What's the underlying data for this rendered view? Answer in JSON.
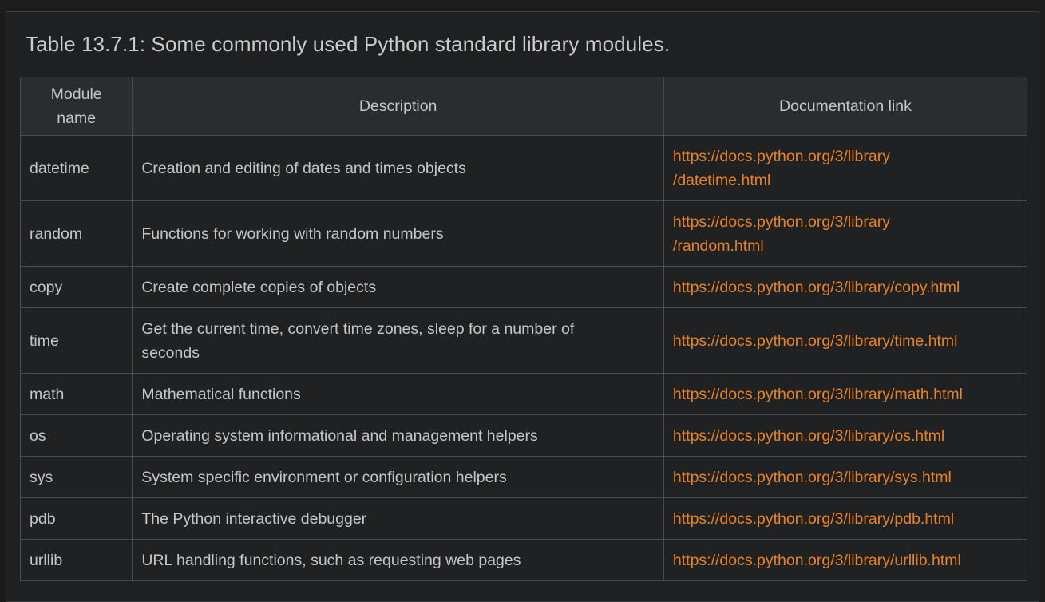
{
  "caption": "Table 13.7.1: Some commonly used Python standard library modules.",
  "table": {
    "headers": {
      "module": "Module name",
      "description": "Description",
      "link": "Documentation link"
    },
    "rows": [
      {
        "module": "datetime",
        "description": "Creation and editing of dates and times objects",
        "link_line1": "https://docs.python.org/3/library",
        "link_line2": "/datetime.html"
      },
      {
        "module": "random",
        "description": "Functions for working with random numbers",
        "link_line1": "https://docs.python.org/3/library",
        "link_line2": "/random.html"
      },
      {
        "module": "copy",
        "description": "Create complete copies of objects",
        "link_line1": "https://docs.python.org/3/library/copy.html",
        "link_line2": ""
      },
      {
        "module": "time",
        "description": "Get the current time, convert time zones, sleep for a number of seconds",
        "link_line1": "https://docs.python.org/3/library/time.html",
        "link_line2": ""
      },
      {
        "module": "math",
        "description": "Mathematical functions",
        "link_line1": "https://docs.python.org/3/library/math.html",
        "link_line2": ""
      },
      {
        "module": "os",
        "description": "Operating system informational and management helpers",
        "link_line1": "https://docs.python.org/3/library/os.html",
        "link_line2": ""
      },
      {
        "module": "sys",
        "description": "System specific environment or configuration helpers",
        "link_line1": "https://docs.python.org/3/library/sys.html",
        "link_line2": ""
      },
      {
        "module": "pdb",
        "description": "The Python interactive debugger",
        "link_line1": "https://docs.python.org/3/library/pdb.html",
        "link_line2": ""
      },
      {
        "module": "urllib",
        "description": "URL handling functions, such as requesting web pages",
        "link_line1": "https://docs.python.org/3/library/urllib.html",
        "link_line2": ""
      }
    ]
  },
  "colors": {
    "background": "#1f2021",
    "header_background": "#2a2d30",
    "text": "#c4c7ca",
    "link": "#e8822a",
    "border": "#4a4c4f"
  }
}
